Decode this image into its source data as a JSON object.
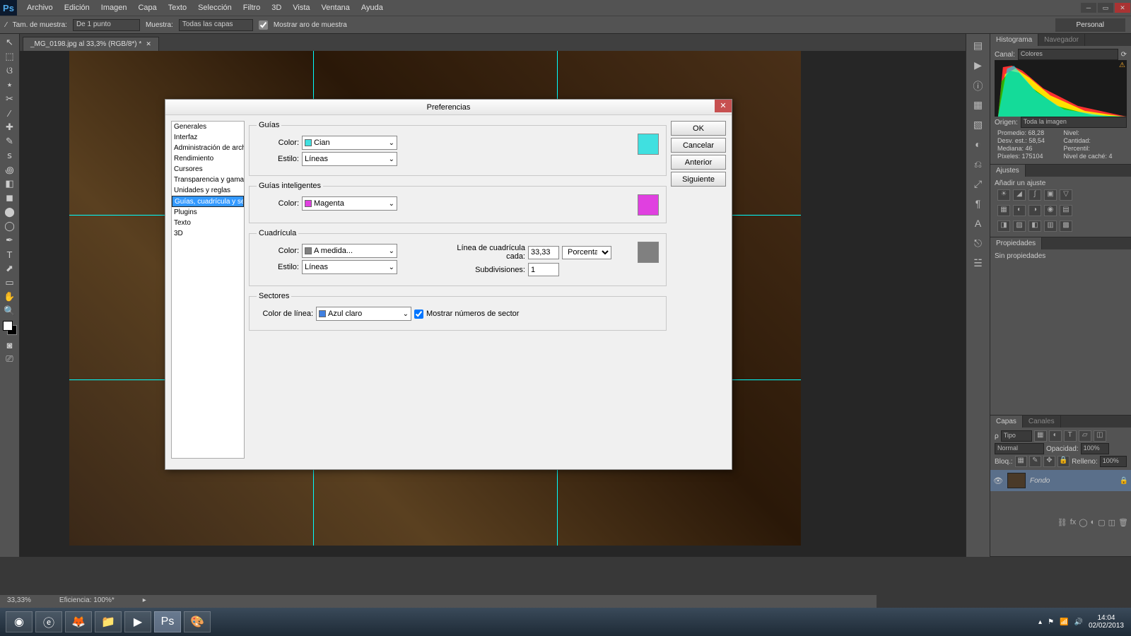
{
  "menu": [
    "Archivo",
    "Edición",
    "Imagen",
    "Capa",
    "Texto",
    "Selección",
    "Filtro",
    "3D",
    "Vista",
    "Ventana",
    "Ayuda"
  ],
  "optbar": {
    "sample_lbl": "Tam. de muestra:",
    "sample": "De 1 punto",
    "muestra_lbl": "Muestra:",
    "muestra": "Todas las capas",
    "ring": "Mostrar aro de muestra",
    "workspace": "Personal"
  },
  "doc_tab": "_MG_0198.jpg al 33,3% (RGB/8*) *",
  "status": {
    "zoom": "33,33%",
    "eff": "Eficiencia: 100%*"
  },
  "histo": {
    "tab1": "Histograma",
    "tab2": "Navegador",
    "canal_lbl": "Canal:",
    "canal": "Colores",
    "origen_lbl": "Origen:",
    "origen": "Toda la imagen",
    "stats": [
      [
        "Promedio:",
        "68,28"
      ],
      [
        "Nivel:",
        ""
      ],
      [
        "Desv. est.:",
        "58,54"
      ],
      [
        "Cantidad:",
        ""
      ],
      [
        "Mediana:",
        "46"
      ],
      [
        "Percentil:",
        ""
      ],
      [
        "Píxeles:",
        "175104"
      ],
      [
        "Nivel de caché:",
        "4"
      ]
    ]
  },
  "ajustes": {
    "title": "Ajustes",
    "sub": "Añadir un ajuste"
  },
  "props": {
    "title": "Propiedades",
    "none": "Sin propiedades"
  },
  "layers": {
    "tab1": "Capas",
    "tab2": "Canales",
    "tipo": "Tipo",
    "mode": "Normal",
    "opac_lbl": "Opacidad:",
    "opac": "100%",
    "bloq": "Bloq.:",
    "fill_lbl": "Relleno:",
    "fill": "100%",
    "name": "Fondo"
  },
  "prefs": {
    "title": "Preferencias",
    "side": [
      "Generales",
      "Interfaz",
      "Administración de archivos",
      "Rendimiento",
      "Cursores",
      "Transparencia y gama",
      "Unidades y reglas",
      "Guías, cuadrícula y sectores",
      "Plugins",
      "Texto",
      "3D"
    ],
    "side_selected": 7,
    "btns": [
      "OK",
      "Cancelar",
      "Anterior",
      "Siguiente"
    ],
    "guias": {
      "legend": "Guías",
      "color_lbl": "Color:",
      "color": "Cian",
      "swatch": "#40E0E0",
      "estilo_lbl": "Estilo:",
      "estilo": "Líneas",
      "preview": "#40E0E0"
    },
    "smart": {
      "legend": "Guías inteligentes",
      "color_lbl": "Color:",
      "color": "Magenta",
      "swatch": "#E040E0",
      "preview": "#E040E0"
    },
    "grid": {
      "legend": "Cuadrícula",
      "color_lbl": "Color:",
      "color": "A medida...",
      "swatch": "#808080",
      "estilo_lbl": "Estilo:",
      "estilo": "Líneas",
      "every_lbl": "Línea de cuadrícula cada:",
      "every": "33,33",
      "unit": "Porcentaje",
      "sub_lbl": "Subdivisiones:",
      "sub": "1",
      "preview": "#808080"
    },
    "slices": {
      "legend": "Sectores",
      "color_lbl": "Color de línea:",
      "color": "Azul claro",
      "swatch": "#4080E0",
      "show": "Mostrar números de sector"
    }
  },
  "taskbar": {
    "time": "14:04",
    "date": "02/02/2013"
  }
}
